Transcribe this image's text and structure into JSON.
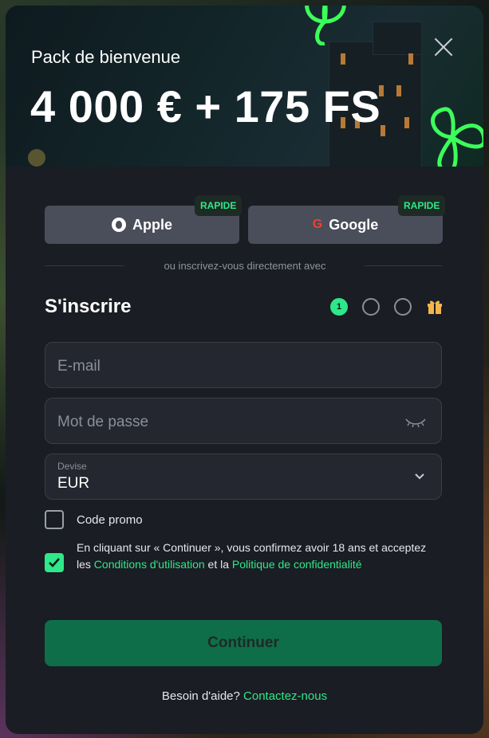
{
  "banner": {
    "subtitle": "Pack de bienvenue",
    "headline": "4 000 € + 175 FS"
  },
  "social": {
    "apple_label": "Apple",
    "google_label": "Google",
    "google_glyph": "G",
    "badge": "RAPIDE"
  },
  "divider_text": "ou inscrivez-vous directement avec",
  "form": {
    "title": "S'inscrire",
    "steps": [
      "1"
    ],
    "email_placeholder": "E-mail",
    "password_placeholder": "Mot de passe",
    "currency_label": "Devise",
    "currency_value": "EUR",
    "promo_label": "Code promo",
    "promo_checked": false,
    "terms_checked": true,
    "terms_prefix": "En cliquant sur « Continuer », vous confirmez avoir 18 ans et acceptez les ",
    "terms_link1": "Conditions d'utilisation",
    "terms_middle": " et la ",
    "terms_link2": "Politique de confidentialité",
    "continue_label": "Continuer"
  },
  "help": {
    "text": "Besoin d'aide? ",
    "link": "Contactez-nous"
  },
  "colors": {
    "accent": "#2ee88a",
    "modal_bg": "#1a1d23",
    "button_bg": "#0f6e4a"
  },
  "icons": [
    "close-icon",
    "apple-icon",
    "google-icon",
    "eye-icon",
    "chevron-down-icon",
    "gift-icon",
    "check-icon",
    "shamrock-icon"
  ]
}
